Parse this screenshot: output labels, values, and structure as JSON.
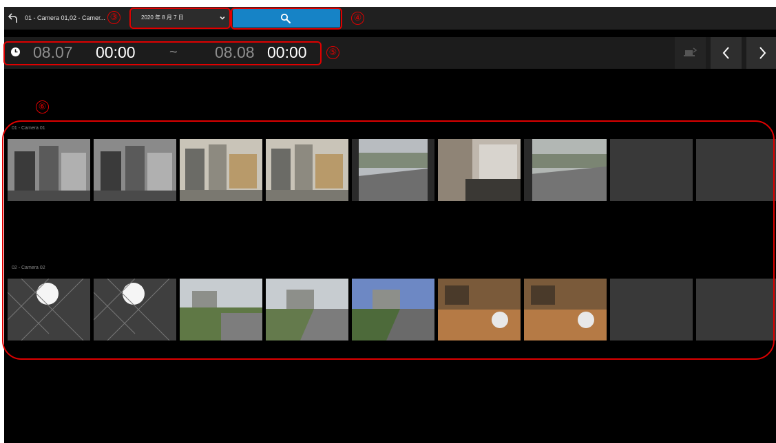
{
  "toolbar": {
    "back_icon": "undo-arrow-icon",
    "camera_selection": "01 - Camera 01,02 - Camer...",
    "date": "2020 年 8 月 7 日",
    "date_chevron_icon": "chevron-down-icon",
    "search_icon": "search-icon",
    "accent_color": "#1683c6"
  },
  "time_range": {
    "clock_icon": "clock-icon",
    "start_date": "08.07",
    "start_time": "00:00",
    "separator": "~",
    "end_date": "08.08",
    "end_time": "00:00"
  },
  "nav": {
    "export_icon": "export-icon",
    "prev_icon": "chevron-left-icon",
    "next_icon": "chevron-right-icon"
  },
  "cameras": [
    {
      "label": "01 - Camera 01",
      "thumbnails": [
        "night-indoor",
        "night-indoor",
        "day-indoor",
        "day-indoor",
        "street-view",
        "office-view",
        "street-view",
        "empty",
        "empty"
      ]
    },
    {
      "label": "02 - Camera 02",
      "thumbnails": [
        "night-light",
        "night-light",
        "outdoor-fence",
        "outdoor-fence",
        "outdoor-fence",
        "office-desk",
        "office-desk",
        "empty",
        "empty"
      ]
    }
  ],
  "annotations": [
    "③",
    "④",
    "⑤",
    "⑥"
  ],
  "annotation_color": "#e00000"
}
